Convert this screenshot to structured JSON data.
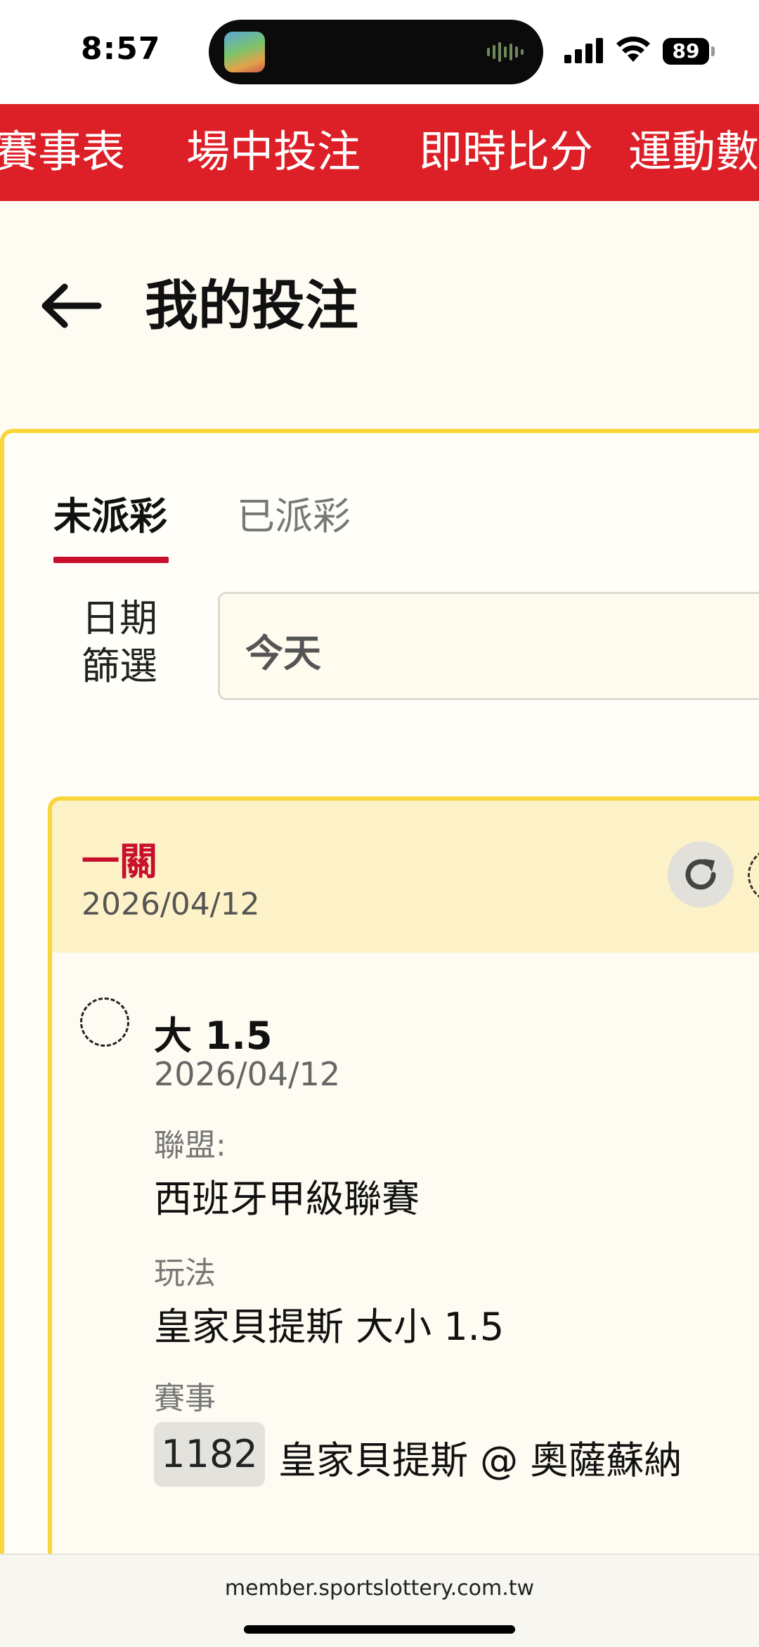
{
  "status_bar": {
    "time": "8:57",
    "battery": "89"
  },
  "top_nav": {
    "items": [
      "賽事表",
      "場中投注",
      "即時比分",
      "運動數"
    ]
  },
  "header": {
    "title": "我的投注"
  },
  "tabs": {
    "active": "未派彩",
    "inactive": "已派彩"
  },
  "filter": {
    "label_line1": "日期",
    "label_line2": "篩選",
    "value": "今天"
  },
  "bet": {
    "type": "一關",
    "date": "2026/04/12",
    "selection": "大 1.5",
    "selection_date": "2026/04/12",
    "league_label": "聯盟:",
    "league": "西班牙甲級聯賽",
    "play_label": "玩法",
    "play": "皇家貝提斯 大小 1.5",
    "match_label": "賽事",
    "match_code": "1182",
    "match": "皇家貝提斯 @ 奧薩蘇納"
  },
  "url_bar": {
    "url": "member.sportslottery.com.tw"
  },
  "colors": {
    "brand_red": "#DD2027",
    "accent_yellow": "#F8D63A",
    "header_tint": "#FDF1C7"
  }
}
